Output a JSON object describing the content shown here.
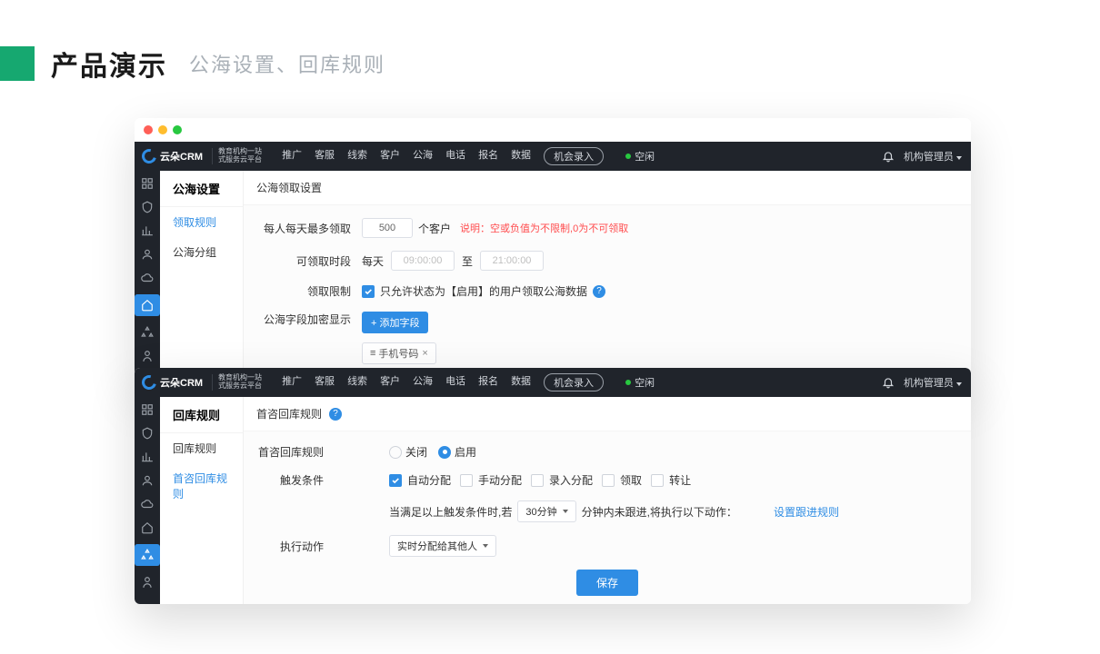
{
  "heading": {
    "main": "产品演示",
    "sub": "公海设置、回库规则"
  },
  "logo": {
    "name": "云朵CRM",
    "slogan_l1": "教育机构一站",
    "slogan_l2": "式服务云平台"
  },
  "nav": [
    "推广",
    "客服",
    "线索",
    "客户",
    "公海",
    "电话",
    "报名",
    "数据"
  ],
  "nav_btn": "机会录入",
  "status": "空闲",
  "user": "机构管理员",
  "win1": {
    "side_title": "公海设置",
    "side_items": [
      "领取规则",
      "公海分组"
    ],
    "section": "公海领取设置",
    "rows": {
      "max_label": "每人每天最多领取",
      "max_value": "500",
      "max_unit": "个客户",
      "max_hint_label": "说明：",
      "max_hint": "空或负值为不限制,0为不可领取",
      "time_label": "可领取时段",
      "time_prefix": "每天",
      "time_from": "09:00:00",
      "time_sep": "至",
      "time_to": "21:00:00",
      "limit_label": "领取限制",
      "limit_text": "只允许状态为【启用】的用户领取公海数据",
      "mask_label": "公海字段加密显示",
      "mask_btn": "+ 添加字段",
      "mask_tag": "手机号码"
    }
  },
  "win2": {
    "side_title": "回库规则",
    "side_items": [
      "回库规则",
      "首咨回库规则"
    ],
    "section": "首咨回库规则",
    "rows": {
      "rule_label": "首咨回库规则",
      "opt_off": "关闭",
      "opt_on": "启用",
      "trig_label": "触发条件",
      "trig_opts": [
        "自动分配",
        "手动分配",
        "录入分配",
        "领取",
        "转让"
      ],
      "cond_pre": "当满足以上触发条件时,若",
      "cond_sel": "30分钟",
      "cond_post": "分钟内未跟进,将执行以下动作：",
      "cond_link": "设置跟进规则",
      "act_label": "执行动作",
      "act_sel": "实时分配给其他人",
      "save": "保存"
    }
  }
}
